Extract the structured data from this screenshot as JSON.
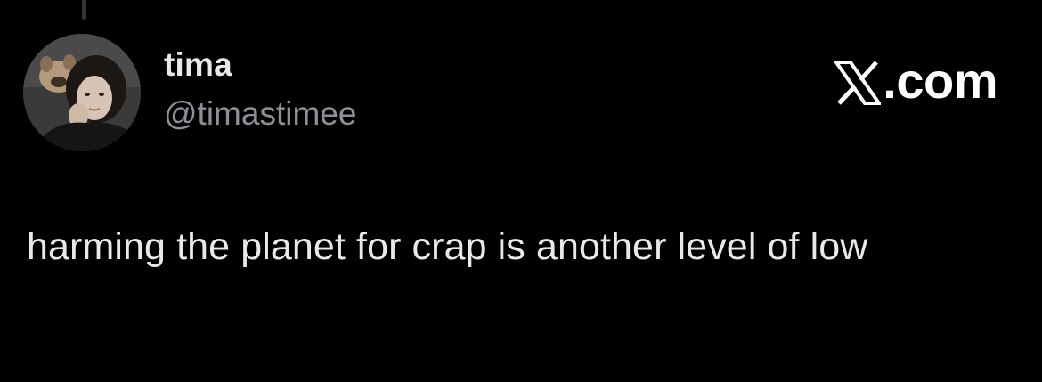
{
  "author": {
    "display_name": "tima",
    "handle": "@timastimee",
    "avatar_icon": "profile-photo"
  },
  "brand": {
    "icon": "x-logo-icon",
    "suffix": ".com"
  },
  "tweet": {
    "text": "harming the planet for crap is another level of low"
  },
  "colors": {
    "background": "#000000",
    "primary_text": "#e7e9ea",
    "secondary_text": "#8b9197",
    "brand": "#ffffff"
  }
}
